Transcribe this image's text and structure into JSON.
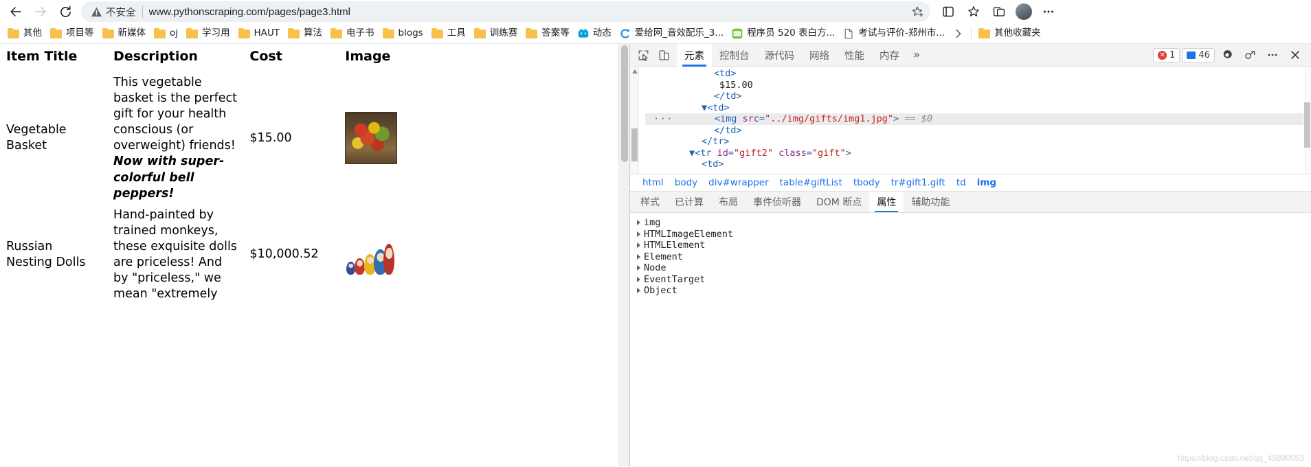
{
  "browser": {
    "nav": {
      "back": "back-arrow",
      "forward": "forward-arrow",
      "reload": "reload"
    },
    "omnibox": {
      "security_label": "不安全",
      "url_text": "www.pythonscraping.com/pages/page3.html",
      "url_host": "www.pythonscraping.com",
      "url_path": "/pages/page3.html"
    },
    "bookmarks": [
      {
        "label": "其他",
        "icon": "folder-icon"
      },
      {
        "label": "项目等",
        "icon": "folder-icon"
      },
      {
        "label": "新媒体",
        "icon": "folder-icon"
      },
      {
        "label": "oj",
        "icon": "folder-icon"
      },
      {
        "label": "学习用",
        "icon": "folder-icon"
      },
      {
        "label": "HAUT",
        "icon": "folder-icon"
      },
      {
        "label": "算法",
        "icon": "folder-icon"
      },
      {
        "label": "电子书",
        "icon": "folder-icon"
      },
      {
        "label": "blogs",
        "icon": "folder-icon"
      },
      {
        "label": "工具",
        "icon": "folder-icon"
      },
      {
        "label": "训练赛",
        "icon": "folder-icon"
      },
      {
        "label": "答案等",
        "icon": "folder-icon"
      },
      {
        "label": "动态",
        "icon": "bilibili-favicon"
      },
      {
        "label": "爱给网_音效配乐_3...",
        "icon": "aigei-favicon"
      },
      {
        "label": "程序员 520 表白方...",
        "icon": "csdn-favicon"
      },
      {
        "label": "考试与评价-郑州市...",
        "icon": "page-favicon"
      }
    ],
    "bookmarks_overflow": "»",
    "other_bookmarks": {
      "label": "其他收藏夹",
      "icon": "folder-icon"
    }
  },
  "page": {
    "table": {
      "headers": [
        "Item Title",
        "Description",
        "Cost",
        "Image"
      ],
      "rows": [
        {
          "title": "Vegetable Basket",
          "description_plain": "This vegetable basket is the perfect gift for your health conscious (or overweight) friends! ",
          "description_emphasis": "Now with super-colorful bell peppers!",
          "cost": "$15.00",
          "image_alt": "vegetable-basket-thumbnail"
        },
        {
          "title": "Russian Nesting Dolls",
          "description_plain": "Hand-painted by trained monkeys, these exquisite dolls are priceless! And by \"priceless,\" we mean \"extremely",
          "description_emphasis": "",
          "cost": "$10,000.52",
          "image_alt": "russian-nesting-dolls-thumbnail"
        }
      ]
    }
  },
  "devtools": {
    "tabs": [
      {
        "label": "元素",
        "active": true
      },
      {
        "label": "控制台",
        "active": false
      },
      {
        "label": "源代码",
        "active": false
      },
      {
        "label": "网络",
        "active": false
      },
      {
        "label": "性能",
        "active": false
      },
      {
        "label": "内存",
        "active": false
      }
    ],
    "more_tabs": "»",
    "error_count": "1",
    "message_count": "46",
    "dom_lines": [
      {
        "indent": 7,
        "html": "&lt;td&gt;",
        "type": "tag"
      },
      {
        "indent": 8,
        "html": "$15.00",
        "type": "text"
      },
      {
        "indent": 7,
        "html": "&lt;/td&gt;",
        "type": "tag"
      },
      {
        "indent": 6,
        "html": "▼&lt;td&gt;",
        "type": "tag"
      },
      {
        "indent": 8,
        "html": "&lt;img src=\"../img/gifts/img1.jpg\"&gt; == $0",
        "type": "selected"
      },
      {
        "indent": 7,
        "html": "&lt;/td&gt;",
        "type": "tag"
      },
      {
        "indent": 6,
        "html": "&lt;/tr&gt;",
        "type": "tag"
      },
      {
        "indent": 5,
        "html": "▼&lt;tr id=\"gift2\" class=\"gift\"&gt;",
        "type": "tag"
      },
      {
        "indent": 6,
        "html": "&lt;td&gt;",
        "type": "tag"
      }
    ],
    "selected_node_src": "../img/gifts/img1.jpg",
    "selected_node_ref": "== $0",
    "breadcrumb": [
      {
        "label": "html",
        "active": false
      },
      {
        "label": "body",
        "active": false
      },
      {
        "label": "div#wrapper",
        "active": false
      },
      {
        "label": "table#giftList",
        "active": false
      },
      {
        "label": "tbody",
        "active": false
      },
      {
        "label": "tr#gift1.gift",
        "active": false
      },
      {
        "label": "td",
        "active": false
      },
      {
        "label": "img",
        "active": true
      }
    ],
    "sub_tabs": [
      {
        "label": "样式",
        "active": false
      },
      {
        "label": "已计算",
        "active": false
      },
      {
        "label": "布局",
        "active": false
      },
      {
        "label": "事件侦听器",
        "active": false
      },
      {
        "label": "DOM 断点",
        "active": false
      },
      {
        "label": "属性",
        "active": true
      },
      {
        "label": "辅助功能",
        "active": false
      }
    ],
    "properties": [
      "img",
      "HTMLImageElement",
      "HTMLElement",
      "Element",
      "Node",
      "EventTarget",
      "Object"
    ],
    "watermark": "https://blog.csdn.net/qq_45890053"
  },
  "colors": {
    "accent": "#1a73e8",
    "folder": "#f7c14b",
    "error": "#e53935",
    "tag": "#1a5fb4",
    "attr_value": "#c5221f"
  }
}
